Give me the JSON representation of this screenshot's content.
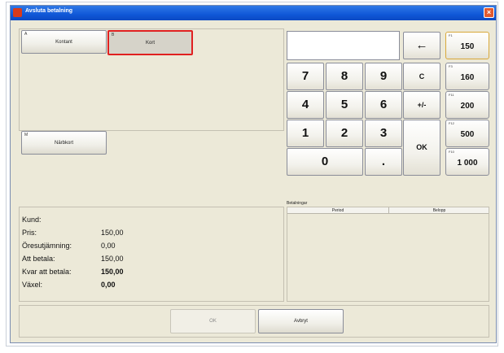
{
  "window": {
    "title": "Avsluta betalning",
    "close_symbol": "×"
  },
  "payment_types": [
    {
      "key": "A",
      "label": "Kontant"
    },
    {
      "key": "B",
      "label": "Kort"
    },
    {
      "key": "M",
      "label": "Närbkort"
    }
  ],
  "display_value": "",
  "keypad": {
    "backspace": "←",
    "clear": "C",
    "plusminus": "+/-",
    "ok": "OK",
    "decimal": ".",
    "digits": [
      "7",
      "8",
      "9",
      "4",
      "5",
      "6",
      "1",
      "2",
      "3",
      "0"
    ]
  },
  "quick_amounts": [
    {
      "key": "F1",
      "label": "150"
    },
    {
      "key": "F3",
      "label": "160"
    },
    {
      "key": "F11",
      "label": "200"
    },
    {
      "key": "F12",
      "label": "500"
    },
    {
      "key": "F10",
      "label": "1 000"
    }
  ],
  "summary": {
    "customer_label": "Kund:",
    "price_label": "Pris:",
    "price_value": "150,00",
    "rounding_label": "Öresutjämning:",
    "rounding_value": "0,00",
    "to_pay_label": "Att betala:",
    "to_pay_value": "150,00",
    "remaining_label": "Kvar att betala:",
    "remaining_value": "150,00",
    "change_label": "Växel:",
    "change_value": "0,00"
  },
  "payments": {
    "title": "Betalningar",
    "columns": [
      "Period",
      "Belopp"
    ]
  },
  "footer": {
    "ok_label": "OK",
    "cancel_label": "Avbryt"
  },
  "colors": {
    "titlebar": "#1058d8",
    "window_bg": "#ece9d8",
    "selected_outline": "#e02020",
    "selected_fill": "#d6d3c9"
  }
}
